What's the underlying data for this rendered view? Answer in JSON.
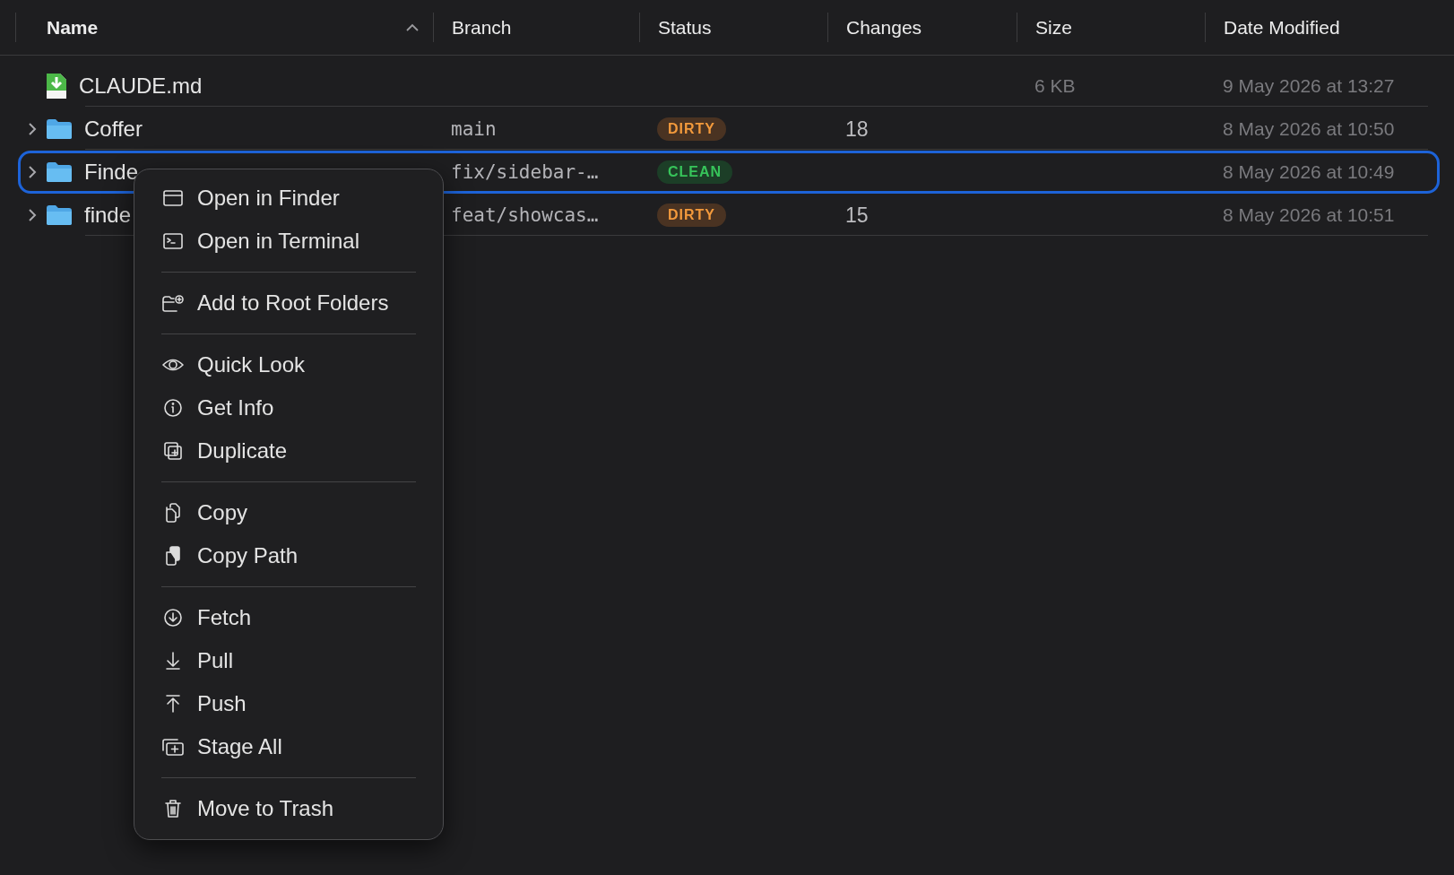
{
  "table": {
    "columns": [
      {
        "label": "Name",
        "sorted": true
      },
      {
        "label": "Branch",
        "sorted": false
      },
      {
        "label": "Status",
        "sorted": false
      },
      {
        "label": "Changes",
        "sorted": false
      },
      {
        "label": "Size",
        "sorted": false
      },
      {
        "label": "Date Modified",
        "sorted": false
      }
    ],
    "rows": [
      {
        "kind": "file",
        "name": "CLAUDE.md",
        "size": "6 KB",
        "date": "9 May 2026 at 13:27",
        "selected": false
      },
      {
        "kind": "folder",
        "name": "Coffer",
        "branch": "main",
        "status": {
          "label": "DIRTY",
          "kind": "dirty"
        },
        "changes": "18",
        "date": "8 May 2026 at 10:50",
        "selected": false
      },
      {
        "kind": "folder",
        "name": "Finde",
        "branch": "fix/sidebar-…",
        "status": {
          "label": "CLEAN",
          "kind": "clean"
        },
        "date": "8 May 2026 at 10:49",
        "selected": true
      },
      {
        "kind": "folder",
        "name": "finde",
        "branch": "feat/showcas…",
        "status": {
          "label": "DIRTY",
          "kind": "dirty"
        },
        "changes": "15",
        "date": "8 May 2026 at 10:51",
        "selected": false
      }
    ]
  },
  "context_menu": {
    "groups": [
      [
        "Open in Finder",
        "Open in Terminal"
      ],
      [
        "Add to Root Folders"
      ],
      [
        "Quick Look",
        "Get Info",
        "Duplicate"
      ],
      [
        "Copy",
        "Copy Path"
      ],
      [
        "Fetch",
        "Pull",
        "Push",
        "Stage All"
      ],
      [
        "Move to Trash"
      ]
    ]
  }
}
